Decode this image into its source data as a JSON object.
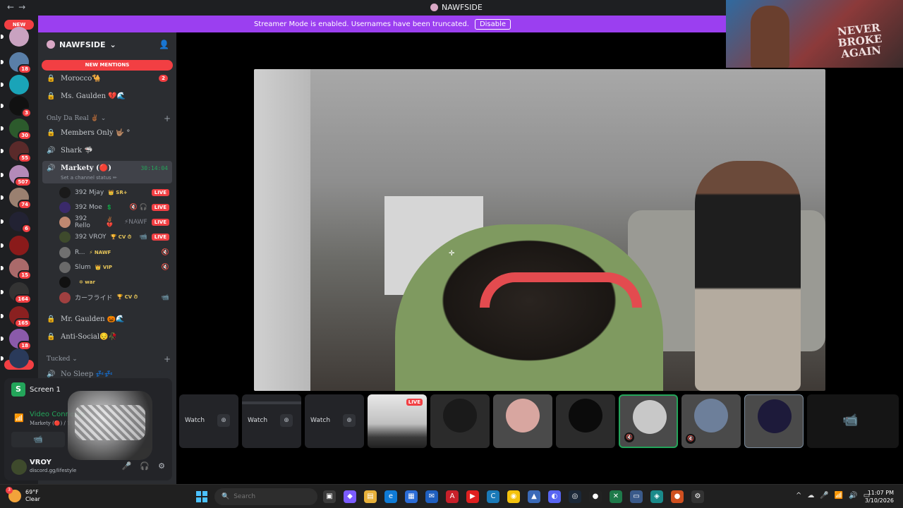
{
  "window": {
    "title": "NAWFSIDE",
    "back": "←",
    "forward": "→"
  },
  "banner": {
    "text": "Streamer Mode is enabled. Usernames have been truncated.",
    "button": "Disable"
  },
  "guilds": {
    "new_top": "NEW",
    "new_bottom": "NEW",
    "items": [
      {
        "badge": "",
        "color": "#c9a2c0"
      },
      {
        "badge": "18",
        "color": "#5a7fa8"
      },
      {
        "badge": "",
        "color": "#1aa4b8"
      },
      {
        "badge": "3",
        "color": "#111111"
      },
      {
        "badge": "30",
        "color": "#2c5a2c"
      },
      {
        "badge": "55",
        "color": "#5a2a2a"
      },
      {
        "badge": "507",
        "color": "#b48ab8"
      },
      {
        "badge": "74",
        "color": "#9a8070"
      },
      {
        "badge": "6",
        "color": "#222233"
      },
      {
        "badge": "",
        "color": "#8a1a1a"
      },
      {
        "badge": "15",
        "color": "#aa6a6a"
      },
      {
        "badge": "164",
        "color": "#333333"
      },
      {
        "badge": "165",
        "color": "#8a2020"
      },
      {
        "badge": "18",
        "color": "#8a5aaa"
      },
      {
        "badge": "",
        "color": "#2a3a5a"
      }
    ]
  },
  "server": {
    "name": "NAWFSIDE",
    "new_mentions": "NEW MENTIONS",
    "channels_top": [
      {
        "name": "Morocco🐪",
        "badge": "2"
      },
      {
        "name": "Ms. Gaulden 💔🌊",
        "badge": ""
      }
    ],
    "category1": "Only Da Real ✌🏾",
    "channels_mid": [
      {
        "name": "Members Only 🤟🏽 °"
      },
      {
        "name": "Shark 🦈"
      }
    ],
    "active_channel": {
      "name": "Markety (🔴)",
      "timer": "30:14:04",
      "status": "Set a channel status ✏"
    },
    "voice_users": [
      {
        "name": "392 Mjay",
        "tag": "👑 SR+",
        "icons": "",
        "live": "LIVE",
        "avatar": "#1a1a1a"
      },
      {
        "name": "392 Moe",
        "tag": "💲",
        "icons": "🔇 🎧",
        "live": "LIVE",
        "avatar": "#3a2a6a"
      },
      {
        "name": "392 Rello",
        "tag": "✌🏾 💔",
        "icons": "⚡NAWF",
        "live": "LIVE",
        "avatar": "#c08870"
      },
      {
        "name": "392 VROY",
        "tag": "🏆 CV ⏱",
        "icons": "📹",
        "live": "LIVE",
        "avatar": "#3e4a2c"
      },
      {
        "name": "R...",
        "tag": "⚡ NAWF",
        "icons": "🔇",
        "live": "",
        "avatar": "#707070"
      },
      {
        "name": "Slum",
        "tag": "👑 VIP",
        "icons": "🔇",
        "live": "",
        "avatar": "#6a6a6a"
      },
      {
        "name": "",
        "tag": "✲ war",
        "icons": "",
        "live": "",
        "avatar": "#111111"
      },
      {
        "name": "カーフライド",
        "tag": "🏆 CV ⏱",
        "icons": "📹",
        "live": "",
        "avatar": "#a04040"
      }
    ],
    "channels_bottom": [
      {
        "name": "Mr. Gaulden 🎃🌊"
      },
      {
        "name": "Anti-Social😔🥀"
      }
    ],
    "category2": "Tucked",
    "channels_last": [
      {
        "name": "No Sleep 💤💤"
      }
    ]
  },
  "user_panel": {
    "screen": "Screen 1",
    "voice_status": "Video Connecte",
    "voice_channel": "Markety (🔴) / 1",
    "username": "VROY",
    "subtext": "discord.gg/lifestyle"
  },
  "pip": {
    "text": "NEVER BROKE AGAIN"
  },
  "tiles": [
    {
      "kind": "watch",
      "label": "Watch"
    },
    {
      "kind": "watch",
      "label": "Watch"
    },
    {
      "kind": "watch",
      "label": "Watch"
    },
    {
      "kind": "stream",
      "live": "LIVE"
    },
    {
      "kind": "avatar",
      "color": "#1a1a1a"
    },
    {
      "kind": "avatar",
      "color": "#d8a6a0"
    },
    {
      "kind": "avatar",
      "color": "#0b0b0b"
    },
    {
      "kind": "avatar",
      "color": "#c8c8c8"
    },
    {
      "kind": "avatar",
      "color": "#6d7f9a"
    },
    {
      "kind": "avatar",
      "color": "#1d1a3a"
    },
    {
      "kind": "camera",
      "color": "#151515"
    }
  ],
  "taskbar": {
    "temp": "69°F",
    "condition": "Clear",
    "weather_badge": "3",
    "search_label": "Search",
    "time": "11:07 PM",
    "date": "3/10/2026"
  }
}
